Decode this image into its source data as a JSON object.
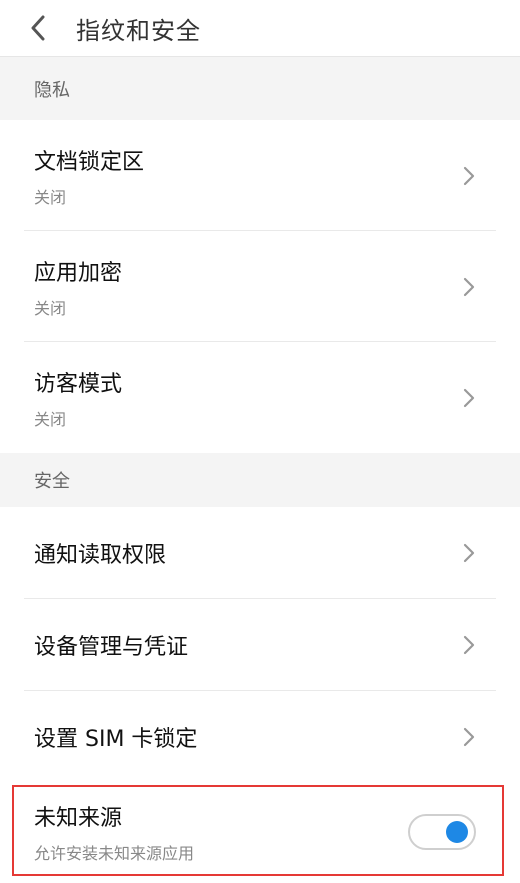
{
  "header": {
    "title": "指纹和安全"
  },
  "sections": {
    "privacy": {
      "title": "隐私",
      "items": [
        {
          "label": "文档锁定区",
          "sub": "关闭"
        },
        {
          "label": "应用加密",
          "sub": "关闭"
        },
        {
          "label": "访客模式",
          "sub": "关闭"
        }
      ]
    },
    "security": {
      "title": "安全",
      "items": [
        {
          "label": "通知读取权限"
        },
        {
          "label": "设备管理与凭证"
        },
        {
          "label": "设置 SIM 卡锁定"
        }
      ]
    }
  },
  "unknown_sources": {
    "label": "未知来源",
    "sub": "允许安装未知来源应用",
    "enabled": true
  },
  "colors": {
    "toggle_on": "#1e88e5",
    "highlight_border": "#e53935"
  }
}
